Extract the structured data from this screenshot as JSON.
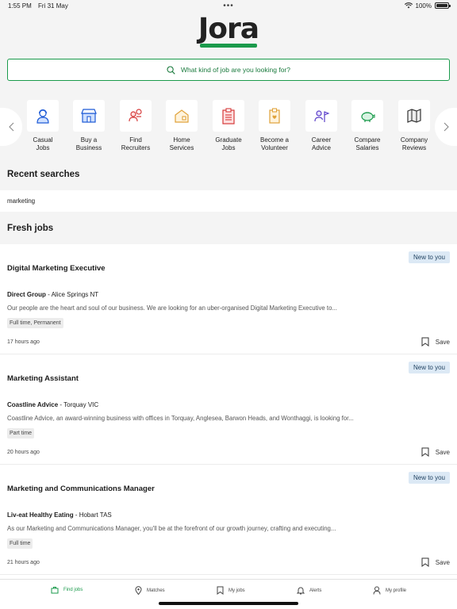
{
  "status_bar": {
    "time": "1:55 PM",
    "date": "Fri 31 May",
    "dots": "•••",
    "battery": "100%"
  },
  "logo": {
    "text": "Jora",
    "brand_color": "#1a9a4b"
  },
  "search": {
    "placeholder": "What kind of job are you looking for?",
    "icon": "search-icon"
  },
  "categories": [
    {
      "label": "Casual\nJobs",
      "icon": "person-headset-icon"
    },
    {
      "label": "Buy a\nBusiness",
      "icon": "storefront-icon"
    },
    {
      "label": "Find\nRecruiters",
      "icon": "recruiters-icon"
    },
    {
      "label": "Home\nServices",
      "icon": "house-icon"
    },
    {
      "label": "Graduate\nJobs",
      "icon": "clipboard-icon"
    },
    {
      "label": "Become a\nVolunteer",
      "icon": "volunteer-clipboard-icon"
    },
    {
      "label": "Career\nAdvice",
      "icon": "career-flag-icon"
    },
    {
      "label": "Compare\nSalaries",
      "icon": "piggy-bank-icon"
    },
    {
      "label": "Company\nReviews",
      "icon": "map-icon"
    }
  ],
  "recent_searches": {
    "title": "Recent searches",
    "items": [
      "marketing"
    ]
  },
  "fresh_jobs": {
    "title": "Fresh jobs",
    "jobs": [
      {
        "badge": "New to you",
        "title": "Digital Marketing Executive",
        "company": "Direct Group",
        "location": " - Alice Springs NT",
        "description": "Our people are the heart and soul of our business. We are looking for an uber-organised Digital Marketing Executive to...",
        "tag": "Full time, Permanent",
        "posted": "17 hours ago",
        "save_label": "Save"
      },
      {
        "badge": "New to you",
        "title": "Marketing Assistant",
        "company": "Coastline Advice",
        "location": " - Torquay VIC",
        "description": "Coastline Advice, an award-winning business with offices in Torquay, Anglesea, Barwon Heads, and Wonthaggi, is looking for...",
        "tag": "Part time",
        "posted": "20 hours ago",
        "save_label": "Save"
      },
      {
        "badge": "New to you",
        "title": "Marketing and Communications Manager",
        "company": "Liv-eat Healthy Eating",
        "location": " - Hobart TAS",
        "description": "As our Marketing and Communications Manager, you'll be at the forefront of our growth journey, crafting and executing...",
        "tag": "Full time",
        "posted": "21 hours ago",
        "save_label": "Save"
      }
    ]
  },
  "tab_bar": [
    {
      "label": "Find jobs",
      "icon": "find-jobs-icon",
      "active": true
    },
    {
      "label": "Matches",
      "icon": "location-pin-icon",
      "active": false
    },
    {
      "label": "My jobs",
      "icon": "bookmark-icon",
      "active": false
    },
    {
      "label": "Alerts",
      "icon": "bell-icon",
      "active": false
    },
    {
      "label": "My profile",
      "icon": "person-icon",
      "active": false
    }
  ]
}
